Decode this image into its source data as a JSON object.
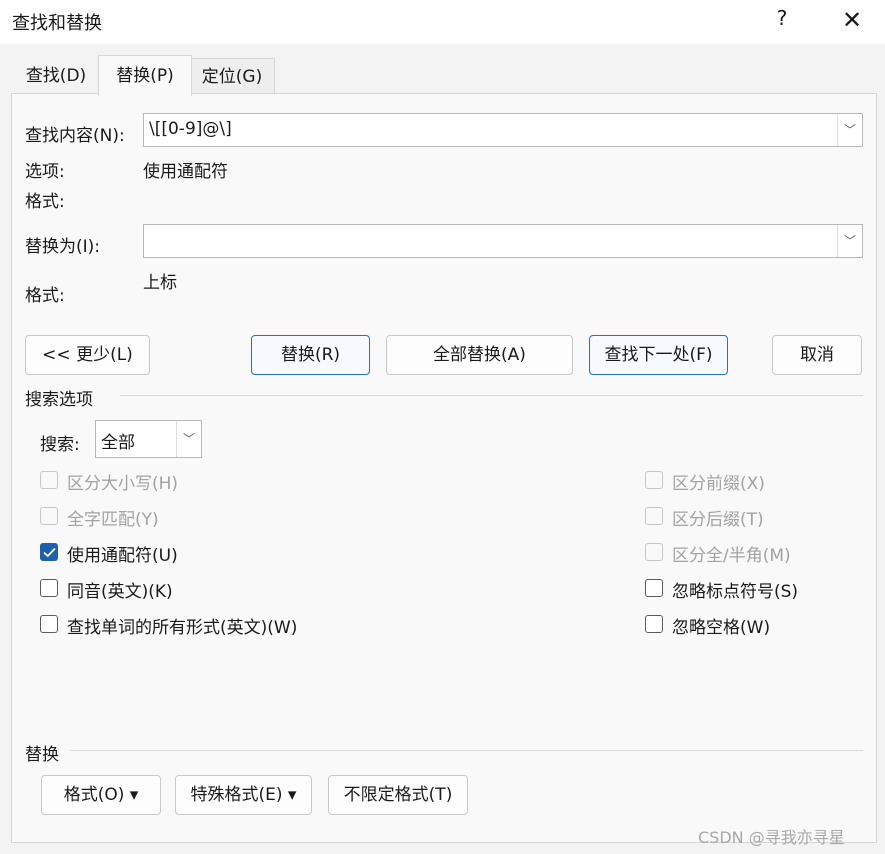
{
  "window": {
    "title": "查找和替换",
    "help_label": "?",
    "close_label": "✕"
  },
  "tabs": [
    {
      "label": "查找(D)"
    },
    {
      "label": "替换(P)"
    },
    {
      "label": "定位(G)"
    }
  ],
  "find": {
    "label": "查找内容(N):",
    "value": "\\[[0-9]@\\]",
    "options_label": "选项:",
    "options_value": "使用通配符",
    "format_label": "格式:"
  },
  "replace": {
    "label": "替换为(I):",
    "value": "",
    "format_label": "格式:",
    "format_value": "上标"
  },
  "buttons": {
    "less": "<< 更少(L)",
    "replace": "替换(R)",
    "replace_all": "全部替换(A)",
    "find_next": "查找下一处(F)",
    "cancel": "取消"
  },
  "search_options": {
    "section_title": "搜索选项",
    "search_label": "搜索:",
    "search_value": "全部",
    "left_checks": [
      {
        "label": "区分大小写(H)",
        "checked": false,
        "disabled": true
      },
      {
        "label": "全字匹配(Y)",
        "checked": false,
        "disabled": true
      },
      {
        "label": "使用通配符(U)",
        "checked": true,
        "disabled": false
      },
      {
        "label": "同音(英文)(K)",
        "checked": false,
        "disabled": false
      },
      {
        "label": "查找单词的所有形式(英文)(W)",
        "checked": false,
        "disabled": false
      }
    ],
    "right_checks": [
      {
        "label": "区分前缀(X)",
        "checked": false,
        "disabled": true
      },
      {
        "label": "区分后缀(T)",
        "checked": false,
        "disabled": true
      },
      {
        "label": "区分全/半角(M)",
        "checked": false,
        "disabled": true
      },
      {
        "label": "忽略标点符号(S)",
        "checked": false,
        "disabled": false
      },
      {
        "label": "忽略空格(W)",
        "checked": false,
        "disabled": false
      }
    ]
  },
  "replace_section": {
    "section_title": "替换",
    "format_button": "格式(O) ▾",
    "special_button": "特殊格式(E) ▾",
    "no_format_button": "不限定格式(T)"
  },
  "watermark": "CSDN @寻我亦寻星",
  "colors": {
    "accent": "#1f5fb0",
    "primary_border": "#2a6fc4"
  }
}
